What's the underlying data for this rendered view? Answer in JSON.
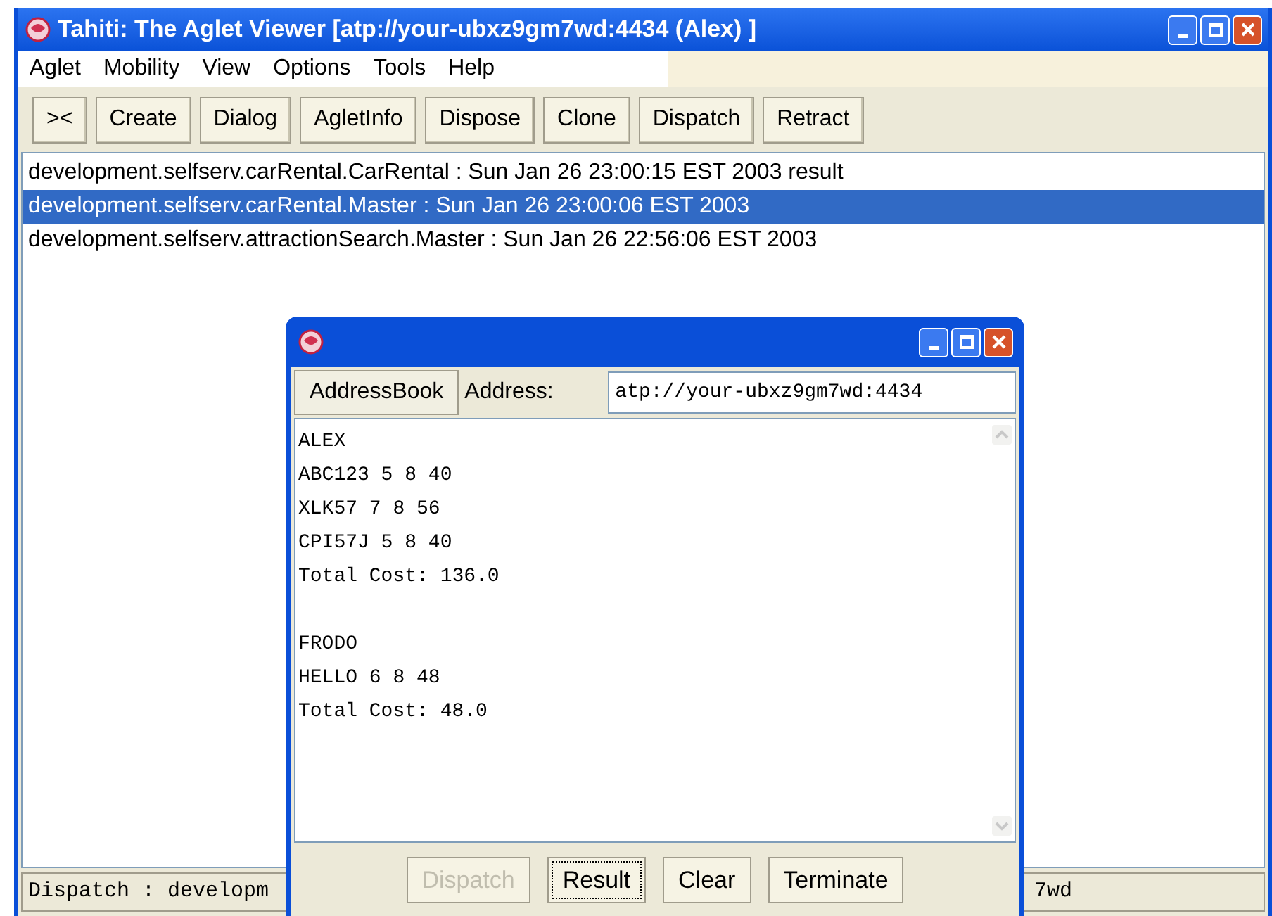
{
  "window": {
    "title": "Tahiti: The Aglet Viewer [atp://your-ubxz9gm7wd:4434 (Alex) ]"
  },
  "menu": [
    "Aglet",
    "Mobility",
    "View",
    "Options",
    "Tools",
    "Help"
  ],
  "toolbar": [
    "><",
    "Create",
    "Dialog",
    "AgletInfo",
    "Dispose",
    "Clone",
    "Dispatch",
    "Retract"
  ],
  "list": [
    {
      "text": "development.selfserv.carRental.CarRental : Sun Jan 26 23:00:15 EST 2003 result",
      "selected": false
    },
    {
      "text": "development.selfserv.carRental.Master : Sun Jan 26 23:00:06 EST 2003",
      "selected": true
    },
    {
      "text": "development.selfserv.attractionSearch.Master : Sun Jan 26 22:56:06 EST 2003",
      "selected": false
    }
  ],
  "status_bar": {
    "left": "Dispatch : developm",
    "right": "7wd"
  },
  "dialog": {
    "address_book": "AddressBook",
    "address_label": "Address:",
    "address_value": "atp://your-ubxz9gm7wd:4434",
    "paragraphs": [
      [
        "ALEX",
        "ABC123 5 8 40",
        "XLK57 7 8 56",
        "CPI57J 5 8 40",
        "Total Cost: 136.0"
      ],
      [
        "FRODO",
        "HELLO 6 8 48",
        "Total Cost: 48.0"
      ]
    ],
    "buttons": [
      {
        "label": "Dispatch",
        "disabled": true,
        "focused": false
      },
      {
        "label": "Result",
        "disabled": false,
        "focused": true
      },
      {
        "label": "Clear",
        "disabled": false,
        "focused": false
      },
      {
        "label": "Terminate",
        "disabled": false,
        "focused": false
      }
    ]
  }
}
